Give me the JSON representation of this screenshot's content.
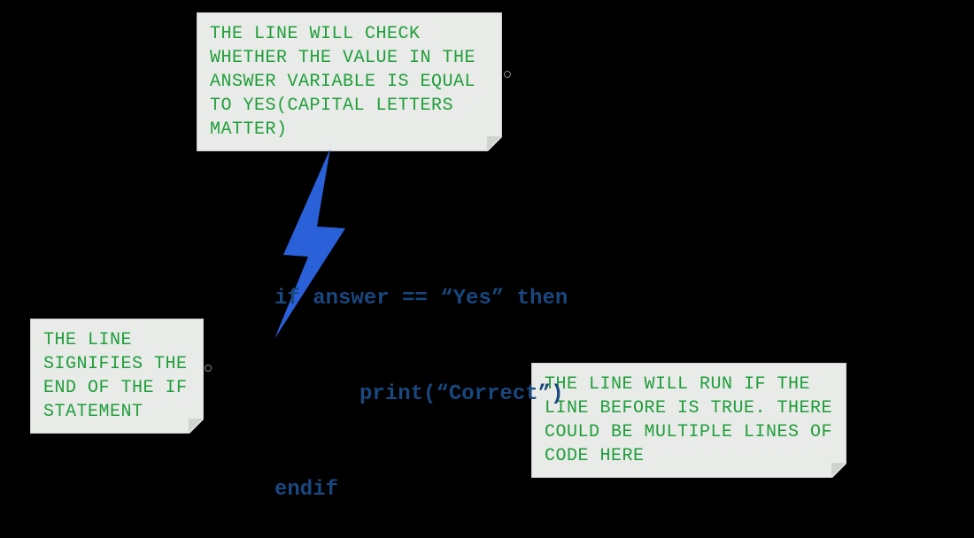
{
  "annotations": {
    "top": "THE LINE WILL CHECK WHETHER THE VALUE IN THE ANSWER VARIABLE IS EQUAL TO YES(CAPITAL LETTERS MATTER)",
    "left": "THE LINE SIGNIFIES THE END OF THE IF STATEMENT",
    "right": "THE LINE WILL RUN IF THE LINE BEFORE IS TRUE. THERE COULD BE MULTIPLE LINES OF CODE HERE"
  },
  "code": {
    "line1": "if answer == “Yes” then",
    "line2": "print(“Correct”)",
    "line3": "endif"
  }
}
